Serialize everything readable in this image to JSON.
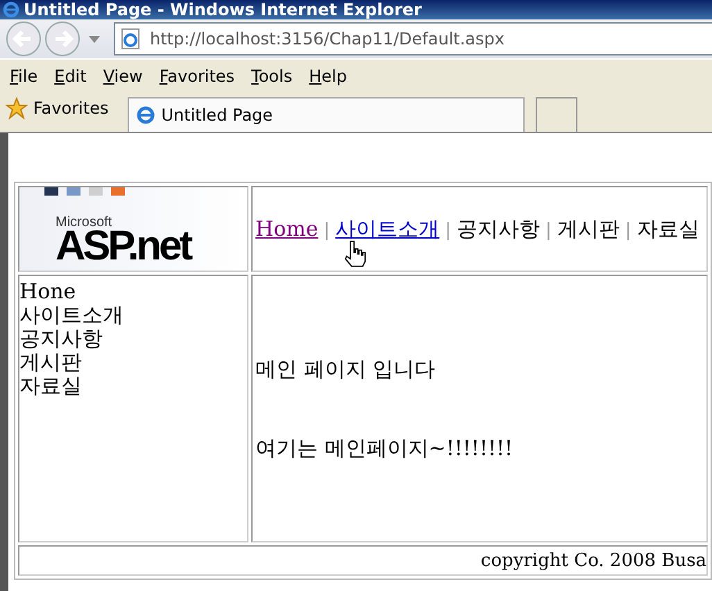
{
  "window": {
    "title": "Untitled Page - Windows Internet Explorer"
  },
  "address_bar": {
    "value": "http://localhost:3156/Chap11/Default.aspx"
  },
  "menu": [
    {
      "label": "File"
    },
    {
      "label": "Edit"
    },
    {
      "label": "View"
    },
    {
      "label": "Favorites"
    },
    {
      "label": "Tools"
    },
    {
      "label": "Help"
    }
  ],
  "favorites_bar": {
    "label": "Favorites",
    "tabs": [
      {
        "label": "Untitled Page",
        "selected": true
      }
    ]
  },
  "logo": {
    "small": "Microsoft",
    "big": "ASP.net"
  },
  "nav": [
    {
      "label": "Home",
      "kind": "visited"
    },
    {
      "label": "|",
      "kind": "separator"
    },
    {
      "label": "사이트소개",
      "kind": "link"
    },
    {
      "label": "|",
      "kind": "separator"
    },
    {
      "label": "공지사항",
      "kind": "text"
    },
    {
      "label": "|",
      "kind": "separator"
    },
    {
      "label": "게시판",
      "kind": "text"
    },
    {
      "label": "|",
      "kind": "separator"
    },
    {
      "label": "자료실",
      "kind": "text"
    }
  ],
  "sidebar": {
    "items": [
      "Hone",
      "사이트소개",
      "공지사항",
      "게시판",
      "자료실"
    ]
  },
  "main": {
    "paragraphs": [
      "메인 페이지 입니다",
      "여기는 메인페이지~!!!!!!!!"
    ]
  },
  "footer": {
    "text": "copyright Co. 2008 Busa"
  }
}
